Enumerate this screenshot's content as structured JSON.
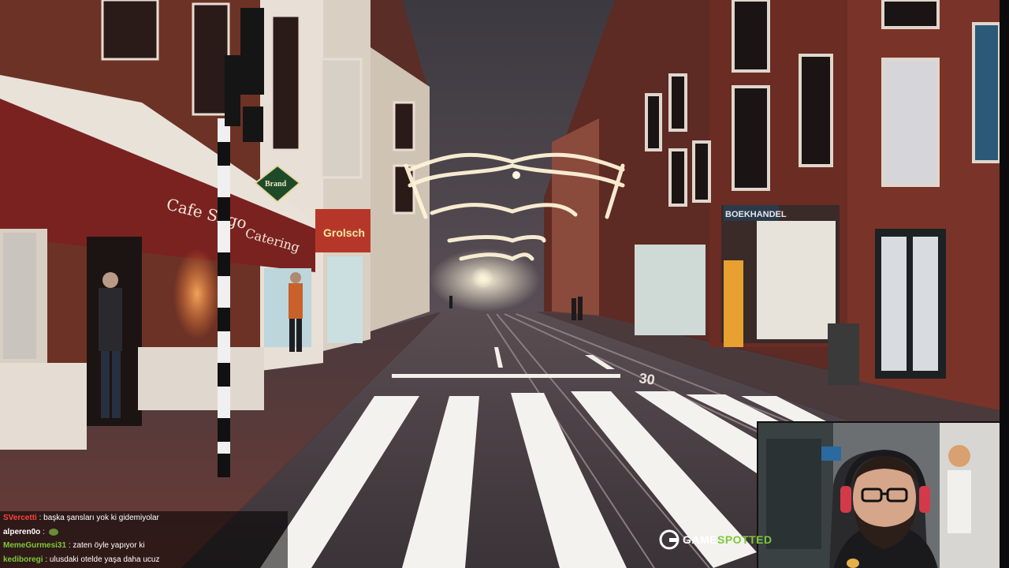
{
  "stream": {
    "brand_name": "GAME",
    "brand_suffix": "SPOTTED",
    "brand_color": "#7ec83a"
  },
  "chat": {
    "messages": [
      {
        "user": "SVercetti",
        "user_color": "#ff4040",
        "text": "başka şansları yok ki gidemiyolar",
        "emote": false
      },
      {
        "user": "alperen0o",
        "user_color": "#ffffff",
        "text": "",
        "emote": true
      },
      {
        "user": "MemeGurmesi31",
        "user_color": "#7ec83a",
        "text": "zaten öyle yapıyor ki",
        "emote": false
      },
      {
        "user": "kediboregi",
        "user_color": "#7ec83a",
        "text": "ulusdaki otelde yaşa daha ucuz",
        "emote": false
      }
    ]
  },
  "scene": {
    "signs": {
      "cafe": "Cafe Sligo",
      "catering": "Catering",
      "brand": "Brand",
      "grolsch": "Grolsch",
      "boekhandel": "BOEKHANDEL",
      "road_marking": "30"
    }
  },
  "icons": {
    "brand_logo": "gamespotted-logo-icon",
    "emote": "emote-icon"
  }
}
